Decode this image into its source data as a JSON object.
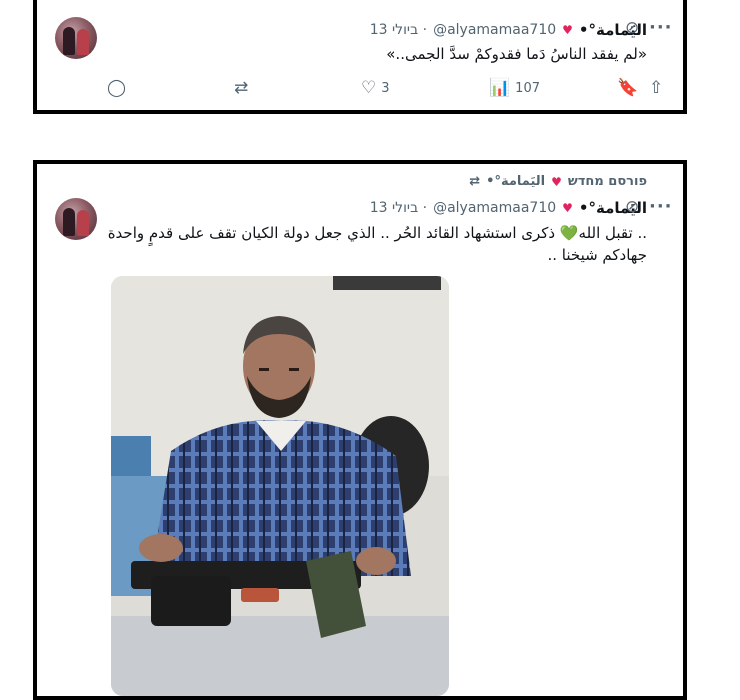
{
  "tweet1": {
    "name": "•°اليَمامة",
    "heart": "♥",
    "handle": "@alyamamaa710",
    "date": "13 ביולי ·",
    "text": "«لم يفقد الناسُ دَما فقدوكمْ سدَّ الجمى..»",
    "actions": {
      "reply_icon": "reply-icon",
      "retweet_icon": "retweet-icon",
      "like_icon": "heart-icon",
      "like_count": "3",
      "views_icon": "views-icon",
      "views_count": "107",
      "bookmark_icon": "bookmark-icon",
      "share_icon": "share-icon"
    }
  },
  "tweet2": {
    "repost_label": "פורסם מחדש",
    "repost_by": "•°اليَمامة",
    "name": "•°اليَمامة",
    "heart": "♥",
    "handle": "@alyamamaa710",
    "date": "13 ביולי ·",
    "text_line1": ".. تقبل الله💚 ذكرى استشهاد القائد الحُر .. الذي جعل دولة الكيان تقف على قدمٍ واحدة",
    "text_line2": "جهادكم شيخنا .."
  }
}
